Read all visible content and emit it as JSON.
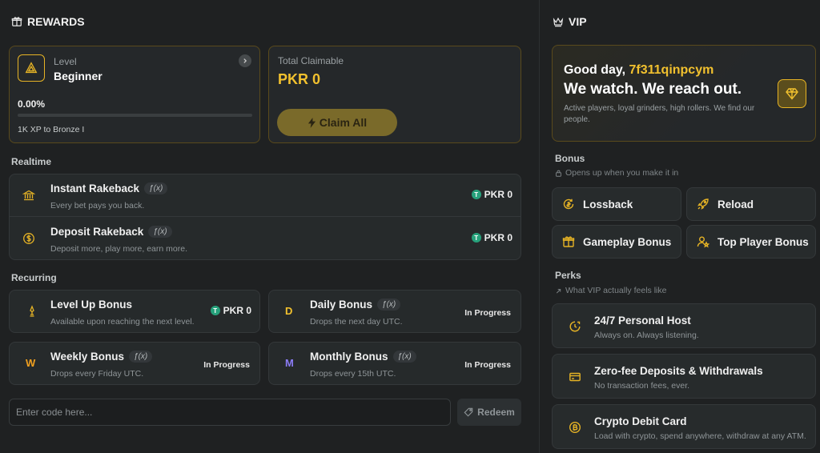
{
  "rewards": {
    "title": "REWARDS",
    "level": {
      "label": "Level",
      "name": "Beginner",
      "progress_text": "0.00%",
      "progress_value": 0.0,
      "next": "1K XP to Bronze I"
    },
    "claimable": {
      "label": "Total Claimable",
      "amount": "PKR 0",
      "button": "Claim All"
    },
    "realtime": {
      "title": "Realtime",
      "items": [
        {
          "title": "Instant Rakeback",
          "fx": "ƒ(x)",
          "sub": "Every bet pays you back.",
          "value": "PKR 0"
        },
        {
          "title": "Deposit Rakeback",
          "fx": "ƒ(x)",
          "sub": "Deposit more, play more, earn more.",
          "value": "PKR 0"
        }
      ]
    },
    "recurring": {
      "title": "Recurring",
      "items": [
        {
          "title": "Level Up Bonus",
          "sub": "Available upon reaching the next level.",
          "value": "PKR 0"
        },
        {
          "letter": "D",
          "title": "Daily Bonus",
          "fx": "ƒ(x)",
          "sub": "Drops the next day UTC.",
          "status": "In Progress"
        },
        {
          "letter": "W",
          "title": "Weekly Bonus",
          "fx": "ƒ(x)",
          "sub": "Drops every Friday UTC.",
          "status": "In Progress"
        },
        {
          "letter": "M",
          "title": "Monthly Bonus",
          "fx": "ƒ(x)",
          "sub": "Drops every 15th UTC.",
          "status": "In Progress"
        }
      ]
    },
    "code": {
      "placeholder": "Enter code here...",
      "button": "Redeem"
    }
  },
  "vip": {
    "title": "VIP",
    "greeting": "Good day,",
    "username": "7f311qinpcym",
    "headline": "We watch. We reach out.",
    "description": "Active players, loyal grinders, high rollers. We find our people.",
    "bonus": {
      "title": "Bonus",
      "note": "Opens up when you make it in",
      "items": [
        "Lossback",
        "Reload",
        "Gameplay Bonus",
        "Top Player Bonus"
      ]
    },
    "perks": {
      "title": "Perks",
      "note": "What VIP actually feels like",
      "items": [
        {
          "title": "24/7 Personal Host",
          "sub": "Always on. Always listening."
        },
        {
          "title": "Zero-fee Deposits & Withdrawals",
          "sub": "No transaction fees, ever."
        },
        {
          "title": "Crypto Debit Card",
          "sub": "Load with crypto, spend anywhere, withdraw at any ATM."
        }
      ]
    }
  },
  "colors": {
    "accent": "#e6b325",
    "tether": "#26a17b",
    "monthly": "#8b7cf6"
  }
}
